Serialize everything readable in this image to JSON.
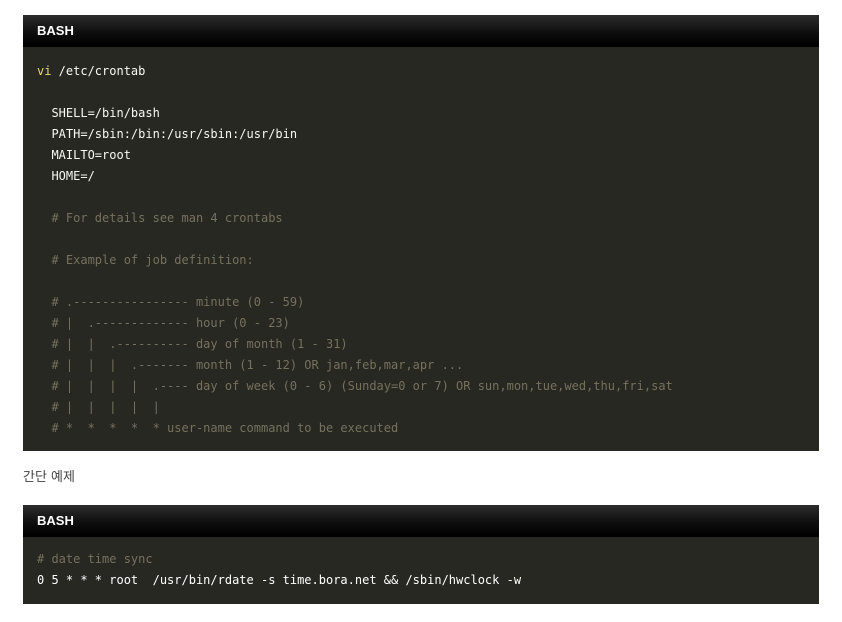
{
  "block1": {
    "language_label": "BASH",
    "lines": [
      {
        "keyword": "vi",
        "text": " /etc/crontab"
      },
      {
        "text": ""
      },
      {
        "text": "  SHELL=/bin/bash"
      },
      {
        "text": "  PATH=/sbin:/bin:/usr/sbin:/usr/bin"
      },
      {
        "text": "  MAILTO=root"
      },
      {
        "text": "  HOME=/"
      },
      {
        "text": ""
      },
      {
        "comment": "  # For details see man 4 crontabs"
      },
      {
        "text": ""
      },
      {
        "comment": "  # Example of job definition:"
      },
      {
        "text": ""
      },
      {
        "comment": "  # .---------------- minute (0 - 59)"
      },
      {
        "comment": "  # |  .------------- hour (0 - 23)"
      },
      {
        "comment": "  # |  |  .---------- day of month (1 - 31)"
      },
      {
        "comment": "  # |  |  |  .------- month (1 - 12) OR jan,feb,mar,apr ..."
      },
      {
        "comment": "  # |  |  |  |  .---- day of week (0 - 6) (Sunday=0 or 7) OR sun,mon,tue,wed,thu,fri,sat"
      },
      {
        "comment": "  # |  |  |  |  |"
      },
      {
        "comment": "  # *  *  *  *  * user-name command to be executed"
      }
    ]
  },
  "between_text": "간단 예제",
  "block2": {
    "language_label": "BASH",
    "lines": [
      {
        "comment": "# date time sync"
      },
      {
        "text": "0 5 * * * root  /usr/bin/rdate -s time.bora.net && /sbin/hwclock -w"
      }
    ]
  },
  "colors": {
    "code_background": "#272822",
    "header_background": "#000000",
    "keyword": "#e6db74",
    "comment": "#75715e",
    "plain_text": "#f8f8f2"
  }
}
